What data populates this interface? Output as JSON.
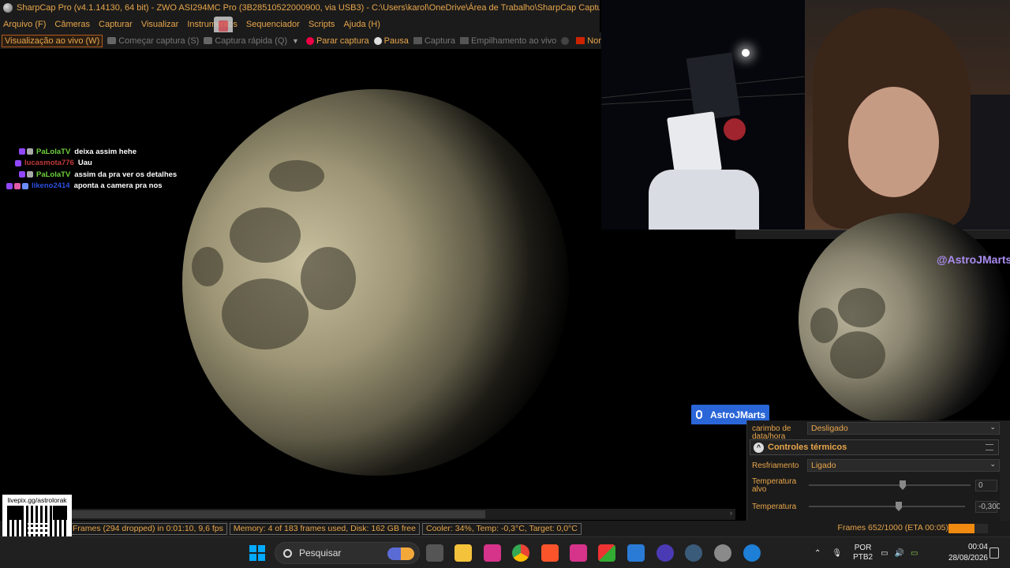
{
  "window": {
    "title": "SharpCap Pro (v4.1.14130, 64 bit) - ZWO ASI294MC Pro (3B28510522000900, via USB3) - C:\\Users\\karol\\OneDrive\\Área de Trabalho\\SharpCap Captures"
  },
  "menu": [
    "Arquivo (F)",
    "Câmeras",
    "Capturar",
    "Visualizar",
    "Instrumentos",
    "Sequenciador",
    "Scripts",
    "Ajuda (H)"
  ],
  "toolbar": {
    "live_view": "Visualização ao vivo (W)",
    "start_capture": "Começar captura (S)",
    "quick_capture": "Captura rápida (Q)",
    "stop_capture": "Parar captura",
    "pause": "Pausa",
    "capture": "Captura",
    "stacking": "Empilhamento ao vivo",
    "target_name": "Nome de destino"
  },
  "chat": [
    {
      "user": "PaLolaTV",
      "user_color": "#6fd13b",
      "message": "deixa assim hehe",
      "badges": [
        "b-purple",
        "b-grey"
      ]
    },
    {
      "user": "lucasmota776",
      "user_color": "#c23a3a",
      "message": "Uau",
      "badges": [
        "b-purple"
      ]
    },
    {
      "user": "PaLolaTV",
      "user_color": "#6fd13b",
      "message": "assim da pra ver os detalhes",
      "badges": [
        "b-purple",
        "b-grey"
      ]
    },
    {
      "user": "likeno2414",
      "user_color": "#2b4fe0",
      "message": "aponta a camera pra nos",
      "badges": [
        "b-purple",
        "b-pink",
        "b-blue"
      ]
    }
  ],
  "overlay": {
    "handle": "@AstroJMarts",
    "name_badge": "AstroJMarts"
  },
  "panel": {
    "timestamp_label": "carimbo de data/hora",
    "timestamp_value": "Desligado",
    "section_title": "Controles térmicos",
    "cooling_label": "Resfriamento",
    "cooling_value": "Ligado",
    "target_temp_label": "Temperatura alvo",
    "target_temp_value": "0",
    "temperature_label": "Temperatura",
    "temperature_value": "-0,300"
  },
  "statusbar": {
    "frames": "Frames (294 dropped) in 0:01:10, 9,6 fps",
    "memory": "Memory: 4 of 183 frames used, Disk: 162 GB free",
    "cooler": "Cooler: 34%, Temp: -0,3°C, Target: 0,0°C",
    "progress_text": "Frames 652/1000 (ETA 00:05)",
    "progress_fraction": 0.652
  },
  "qr": {
    "label": "livepix.gg/astrolorak"
  },
  "taskbar": {
    "search_placeholder": "Pesquisar",
    "language": "POR",
    "layout": "PTB2",
    "time": "00:04",
    "date": "28/08/2026"
  }
}
